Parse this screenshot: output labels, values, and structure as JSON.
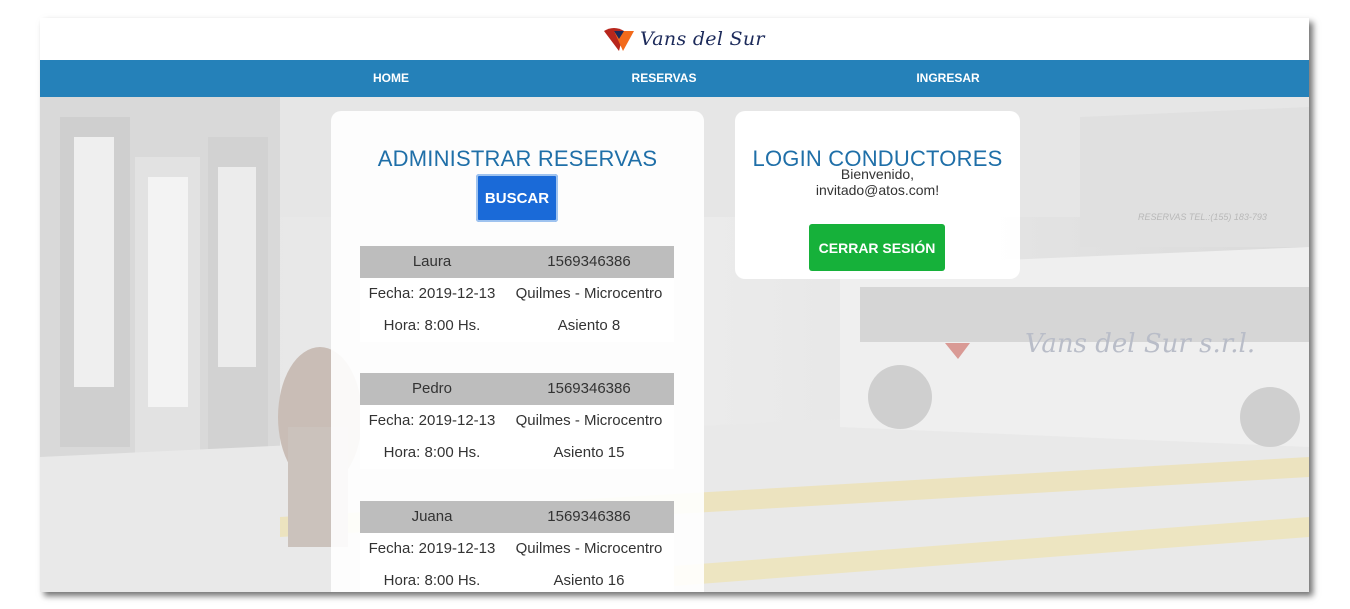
{
  "brand": {
    "name": "Vans del Sur",
    "logo_icon": "vans-del-sur-logo-icon",
    "accent": "#f26a1b"
  },
  "nav": {
    "home": "HOME",
    "reservas": "RESERVAS",
    "ingresar": "INGRESAR",
    "color": "#2581b9"
  },
  "reservas_panel": {
    "title": "ADMINISTRAR RESERVAS",
    "search_button": "BUSCAR",
    "reservations": [
      {
        "name": "Laura",
        "phone": "1569346386",
        "fecha": "Fecha: 2019-12-13",
        "route": "Quilmes - Microcentro",
        "hora": "Hora: 8:00 Hs.",
        "seat": "Asiento 8"
      },
      {
        "name": "Pedro",
        "phone": "1569346386",
        "fecha": "Fecha: 2019-12-13",
        "route": "Quilmes - Microcentro",
        "hora": "Hora: 8:00 Hs.",
        "seat": "Asiento 15"
      },
      {
        "name": "Juana",
        "phone": "1569346386",
        "fecha": "Fecha: 2019-12-13",
        "route": "Quilmes - Microcentro",
        "hora": "Hora: 8:00 Hs.",
        "seat": "Asiento 16"
      }
    ]
  },
  "login_panel": {
    "title": "LOGIN CONDUCTORES",
    "welcome_line1": "Bienvenido,",
    "welcome_line2": "invitado@atos.com!",
    "logout_button": "CERRAR SESIÓN",
    "logout_color": "#16b13a"
  },
  "background": {
    "van_sign": "RESERVAS TEL.:(155) 183-793",
    "van_brand": "Vans del Sur s.r.l."
  }
}
